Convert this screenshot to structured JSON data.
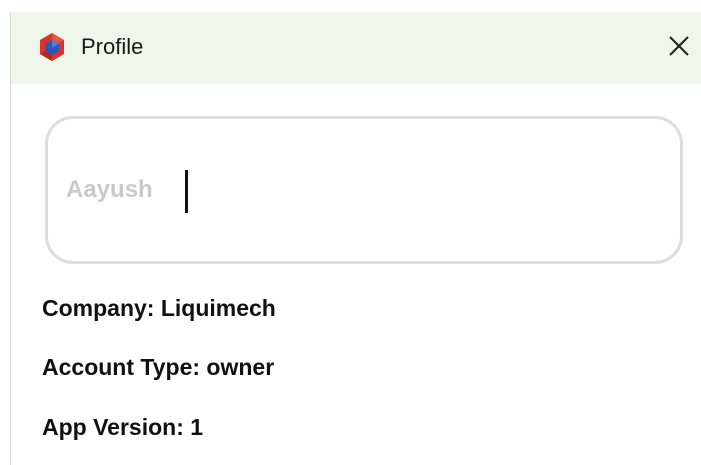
{
  "window": {
    "title": "Profile",
    "app_icon": "app-logo-icon",
    "close_icon": "close-icon"
  },
  "profile": {
    "name_value": "Aayush",
    "company_label": "Company:",
    "company_value": "Liquimech",
    "account_type_label": "Account Type:",
    "account_type_value": "owner",
    "app_version_label": "App Version:",
    "app_version_value": "1"
  },
  "colors": {
    "titlebar_bg": "#eef7ea",
    "logo_red": "#d8342c",
    "logo_blue": "#2b57b8",
    "input_text": "#c9c9c9"
  }
}
